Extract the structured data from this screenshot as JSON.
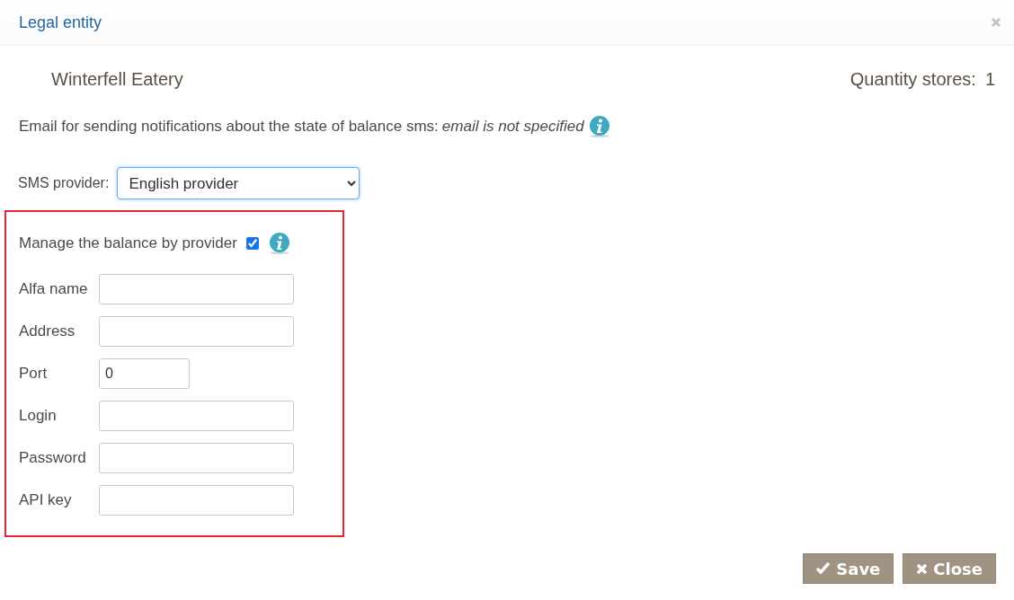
{
  "dialog": {
    "title": "Legal entity"
  },
  "entity": {
    "name": "Winterfell Eatery",
    "stores_label": "Quantity stores:",
    "stores_count": "1"
  },
  "email": {
    "label": "Email for sending notifications about the state of balance sms:",
    "value": "email is not specified"
  },
  "sms_provider": {
    "label": "SMS provider:",
    "value": "English provider"
  },
  "manage_balance": {
    "label": "Manage the balance by provider",
    "checked": true
  },
  "fields": [
    {
      "label": "Alfa name",
      "kind": "text"
    },
    {
      "label": "Address",
      "kind": "text"
    },
    {
      "label": "Port",
      "kind": "number",
      "value": "0"
    },
    {
      "label": "Login",
      "kind": "text"
    },
    {
      "label": "Password",
      "kind": "text"
    },
    {
      "label": "API key",
      "kind": "text"
    }
  ],
  "buttons": [
    {
      "label": "Save",
      "kind": "save"
    },
    {
      "label": "Close",
      "kind": "close"
    }
  ]
}
